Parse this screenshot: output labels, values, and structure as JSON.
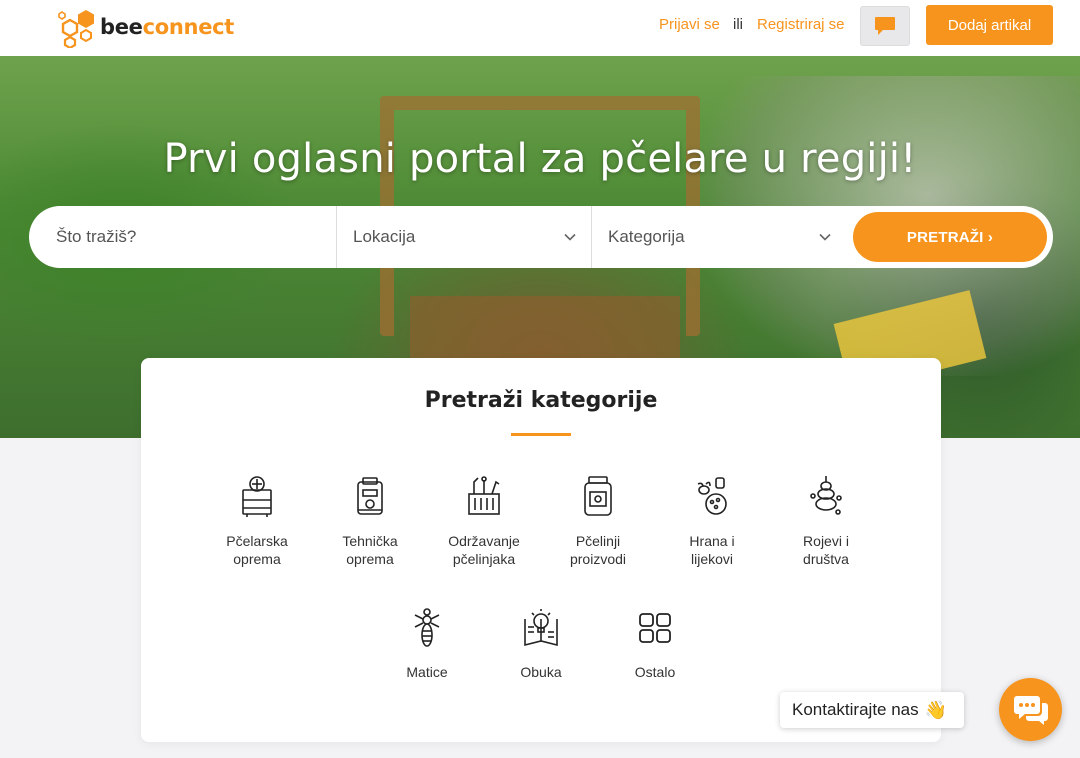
{
  "header": {
    "logo_part1": "bee",
    "logo_part2": "connect",
    "login_label": "Prijavi se",
    "or_label": "ili",
    "register_label": "Registriraj se",
    "add_item_label": "Dodaj artikal"
  },
  "hero": {
    "title": "Prvi oglasni portal za pčelare u regiji!"
  },
  "search": {
    "query_placeholder": "Što tražiš?",
    "location_label": "Lokacija",
    "category_label": "Kategorija",
    "button_label": "PRETRAŽI ›"
  },
  "categories": {
    "title": "Pretraži kategorije",
    "items": [
      {
        "line1": "Pčelarska",
        "line2": "oprema"
      },
      {
        "line1": "Tehnička",
        "line2": "oprema"
      },
      {
        "line1": "Održavanje",
        "line2": "pčelinjaka"
      },
      {
        "line1": "Pčelinji",
        "line2": "proizvodi"
      },
      {
        "line1": "Hrana i",
        "line2": "lijekovi"
      },
      {
        "line1": "Rojevi i",
        "line2": "društva"
      },
      {
        "line1": "Matice",
        "line2": ""
      },
      {
        "line1": "Obuka",
        "line2": ""
      },
      {
        "line1": "Ostalo",
        "line2": ""
      }
    ]
  },
  "contact": {
    "label": "Kontaktirajte nas",
    "emoji": "👋"
  },
  "colors": {
    "accent": "#f7941d",
    "text": "#222222",
    "background": "#f3f3f5"
  }
}
